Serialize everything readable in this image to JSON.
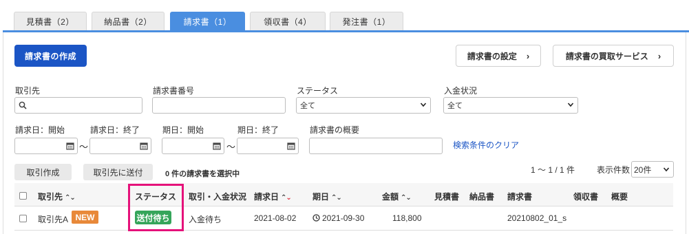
{
  "tabs": [
    {
      "label": "見積書（2）"
    },
    {
      "label": "納品書（2）"
    },
    {
      "label": "請求書（1）"
    },
    {
      "label": "領収書（4）"
    },
    {
      "label": "発注書（1）"
    }
  ],
  "toolbar": {
    "create_label": "請求書の作成",
    "settings_label": "請求書の設定",
    "purchase_label": "請求書の買取サービス"
  },
  "filters": {
    "client_label": "取引先",
    "number_label": "請求書番号",
    "status_label": "ステータス",
    "status_value": "全て",
    "payment_label": "入金状況",
    "payment_value": "全て",
    "invoice_start_label": "請求日：開始",
    "invoice_end_label": "請求日：終了",
    "due_start_label": "期日：開始",
    "due_end_label": "期日：終了",
    "summary_label": "請求書の概要",
    "tilde": "〜",
    "clear_link": "検索条件のクリア"
  },
  "actions": {
    "create_deal_label": "取引作成",
    "send_label": "取引先に送付",
    "selected_text": "0 件の請求書を選択中",
    "range_text": "1 〜 1 / 1 件",
    "per_page_label": "表示件数",
    "per_page_value": "20件"
  },
  "table": {
    "headers": {
      "client": "取引先",
      "status": "ステータス",
      "deal": "取引・入金状況",
      "invoice_date": "請求日",
      "due_date": "期日",
      "amount": "金額",
      "quote": "見積書",
      "delivery": "納品書",
      "invoice": "請求書",
      "receipt": "領収書",
      "summary": "概要"
    },
    "rows": [
      {
        "client": "取引先A",
        "badge": "NEW",
        "status": "送付待ち",
        "deal": "入金待ち",
        "invoice_date": "2021-08-02",
        "due_date": "2021-09-30",
        "amount": "118,800",
        "invoice": "20210802_01_s"
      }
    ]
  },
  "colors": {
    "accent": "#4a8ee0",
    "primary": "#1b55c5",
    "status_green": "#35a55a",
    "new_orange": "#e8893a",
    "highlight": "#e5127a"
  }
}
